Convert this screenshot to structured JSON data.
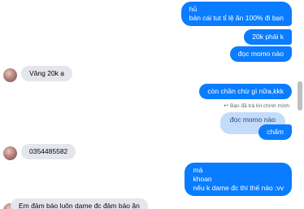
{
  "conversation": {
    "messages": [
      {
        "sender": "me",
        "lines": [
          "hủ",
          "bán cái tut tỉ lệ ăn 100% đi bạn"
        ]
      },
      {
        "sender": "me",
        "lines": [
          "20k phải k"
        ]
      },
      {
        "sender": "me",
        "lines": [
          "đọc momo nào"
        ]
      },
      {
        "sender": "them",
        "lines": [
          "Vâng 20k ạ"
        ]
      },
      {
        "sender": "me",
        "lines": [
          "còn chần chừ gì nữa,kkk"
        ]
      },
      {
        "sender": "me",
        "reply_note": "Bạn đã trả lời chính mình",
        "quoted": "đọc momo nào",
        "lines": [
          "chấm"
        ]
      },
      {
        "sender": "them",
        "lines": [
          "0354485582"
        ]
      },
      {
        "sender": "me",
        "lines": [
          "mà",
          "khoan",
          "nếu k dame đc thì thế nào :vv"
        ]
      },
      {
        "sender": "them",
        "lines": [
          "Em đảm bảo luôn dame đc đảm bảo ăn"
        ]
      }
    ]
  },
  "icons": {
    "reply": "reply-arrow-icon",
    "avatar": "contact-avatar"
  },
  "colors": {
    "outgoing": "#0a7cff",
    "incoming": "#e4e6eb",
    "quoted": "#c4dcfc",
    "scroll_thumb": "#bcc0c4"
  }
}
